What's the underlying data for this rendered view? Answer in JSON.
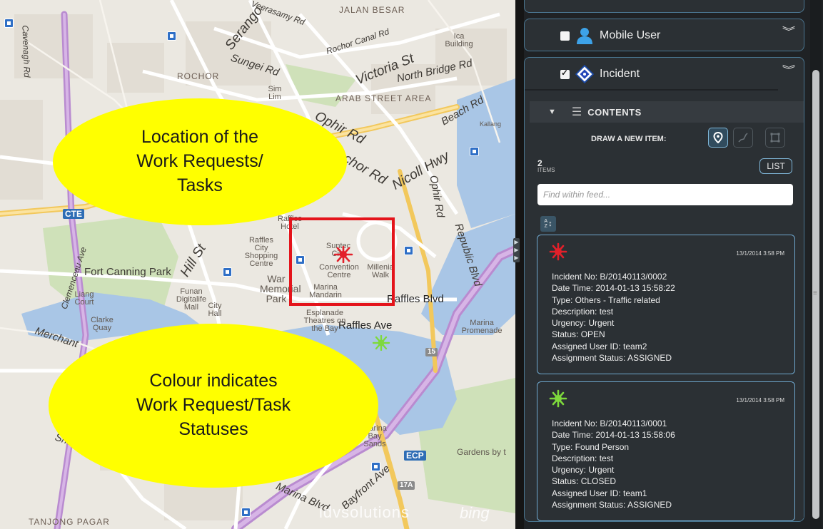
{
  "map": {
    "overlay": {
      "top_bubble": [
        "Location of the",
        "Work Requests/",
        "Tasks"
      ],
      "bottom_bubble": [
        "Colour indicates",
        "Work Request/Task",
        "Statuses"
      ]
    },
    "labels": {
      "jalan_besar": "JALAN BESAR",
      "rochor": "ROCHOR",
      "arab_street": "ARAB STREET AREA",
      "tanjong_pagar": "TANJONG PAGAR",
      "victoria_st": "Victoria St",
      "ophir_rd": "Ophir Rd",
      "ophir_rd_2": "Ophir Rd",
      "nicoll_hwy": "Nicoll Hwy",
      "rochor_rd": "chor Rd",
      "north_bridge": "North Bridge Rd",
      "beach_rd": "Beach Rd",
      "rochor_canal": "Rochor Canal Rd",
      "sungei_rd": "Sungei Rd",
      "serangoon": "Serango",
      "veerasamy": "Veerasamy Rd",
      "raffles_blvd": "Raffles Blvd",
      "raffles_ave": "Raffles Ave",
      "republic_blvd": "Republic Blvd",
      "hill_st": "Hill St",
      "fort_canning": "Fort Canning Park",
      "marina_blvd": "Marina Blvd",
      "bayfront": "Bayfront Ave",
      "smith_st": "Smith St",
      "merchant": "Merchant",
      "cte": "CTE",
      "ecp": "ECP",
      "suntec": "Suntec City",
      "convention": "Convention Centre",
      "millenia": "Millenia Walk",
      "marina_mandarin": "Marina Mandarin",
      "esplanade": "Esplanade Theatres on the Bay",
      "raffles_hotel": "Raffles Hotel",
      "raffles_city": "Raffles City Shopping Centre",
      "war_memorial": "War Memorial Park",
      "marina_promenade": "Marina Promenade",
      "marina_bay_sands": "Marina Bay Sands",
      "gardens_by": "Gardens by t",
      "funan": "Funan Digitalife Mall",
      "city_hall": "City Hall",
      "clarke_quay": "Clarke Quay",
      "liang_court": "Liang Court",
      "kallang": "Kallang",
      "ica": "Ica Building",
      "sim_lim": "Sim Lim",
      "cavenagh": "Cavenagh Rd",
      "clemenceau": "Clemenceau Ave",
      "nil_15": "15",
      "nil_17a": "17A"
    },
    "watermark": "idvsolutions",
    "bing": "bing"
  },
  "panel": {
    "layers": [
      {
        "name": "Mobile User",
        "checked": false,
        "icon": "person-icon"
      },
      {
        "name": "Incident",
        "checked": true,
        "icon": "incident-diamond-icon"
      }
    ],
    "contents": {
      "header": "CONTENTS",
      "draw_label": "DRAW A NEW ITEM:",
      "item_count": "2",
      "items_label": "ITEMS",
      "list_button": "LIST",
      "search_placeholder": "Find within feed...",
      "sort_icon": "sort-az-icon"
    },
    "items": [
      {
        "status_color": "#e3202a",
        "timestamp": "13/1/2014 3:58 PM",
        "lines": [
          "Incident No: B/20140113/0002",
          "Date Time: 2014-01-13 15:58:22",
          "Type: Others - Traffic related",
          "Description: test",
          "Urgency: Urgent",
          "Status: OPEN",
          "Assigned User ID: team2",
          "Assignment Status: ASSIGNED"
        ]
      },
      {
        "status_color": "#7ed93c",
        "timestamp": "13/1/2014 3:58 PM",
        "lines": [
          "Incident No: B/20140113/0001",
          "Date Time: 2014-01-13 15:58:06",
          "Type: Found Person",
          "Description: test",
          "Urgency: Urgent",
          "Status: CLOSED",
          "Assigned User ID: team1",
          "Assignment Status: ASSIGNED"
        ]
      }
    ]
  },
  "colors": {
    "highlight": "#e4141b",
    "bubble": "#ffff00",
    "panel_bg": "#1f2225",
    "card_border": "#6fa8cf",
    "open_status": "#e3202a",
    "closed_status": "#7ed93c"
  }
}
